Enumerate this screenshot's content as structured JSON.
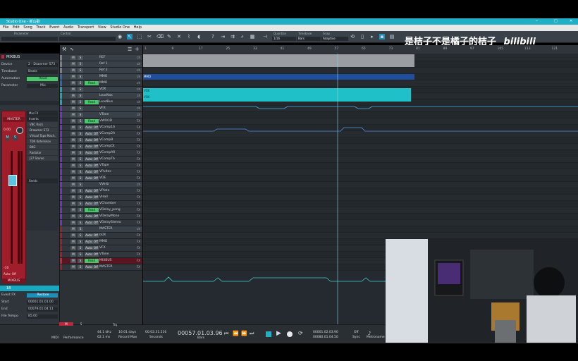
{
  "window": {
    "title": "Studio One - 新山歌",
    "controls": [
      "─",
      "□",
      "✕"
    ]
  },
  "menu": [
    "File",
    "Edit",
    "Song",
    "Track",
    "Event",
    "Audio",
    "Transport",
    "View",
    "Studio One",
    "Help"
  ],
  "toolbar": {
    "parameter_label": "Parameter",
    "control_label": "Control",
    "quantize_label": "Quantize",
    "quantize_value": "1/16",
    "timebase_label": "Timebase",
    "timebase_value": "Bars",
    "snap_label": "Snap",
    "snap_value": "Adaptive"
  },
  "watermark": {
    "text": "是桔子不是橘子的桔子",
    "logo": "bilibili"
  },
  "inspector": {
    "track_name": "MIXBUS",
    "rows": [
      {
        "label": "Device",
        "value": "2 - Drawmer S73"
      },
      {
        "label": "Timebase",
        "value": "Beats"
      },
      {
        "label": "Automation",
        "value": "Read"
      },
      {
        "label": "Parameter",
        "value": "Mix"
      }
    ],
    "channel_name": "MASTER",
    "channel_value": "0.00",
    "fx_title": "Mix FX",
    "inserts_label": "Inserts",
    "inserts": [
      "VBC Rack",
      "Drawmer S73",
      "Virtual Tape Mach.",
      "TDR Kotelnikov",
      "BKG",
      "Radiator",
      "J37 Stereo"
    ],
    "sends_label": "Sends",
    "fader_value": "-10",
    "auto_label": "Auto: Off",
    "strip_label": "MIXBUS",
    "event_track_no": "18",
    "event_fx_label": "Event FX",
    "event_fx_button": "Restore",
    "event_rows": [
      {
        "label": "Start",
        "value": "00001.01.01.00"
      },
      {
        "label": "End",
        "value": "00079.01.04.11"
      },
      {
        "label": "File Tempo",
        "value": "85.00"
      }
    ]
  },
  "tracks": [
    {
      "name": "REF",
      "color": "#7a7f85",
      "mode": "",
      "end": "ch"
    },
    {
      "name": "Ref 1",
      "color": "#7a7f85",
      "mode": "",
      "end": "ch"
    },
    {
      "name": "Ref 2",
      "color": "#7a7f85",
      "mode": "",
      "end": "ch"
    },
    {
      "name": "MMO",
      "color": "#2d6aa8",
      "mode": "",
      "end": "ch"
    },
    {
      "name": "MMO",
      "color": "#2d6aa8",
      "mode": "Read",
      "end": "ch"
    },
    {
      "name": "VOX",
      "color": "#1aa7a7",
      "mode": "",
      "end": "ch"
    },
    {
      "name": "LeadVox",
      "color": "#1aa7a7",
      "mode": "",
      "end": "ch"
    },
    {
      "name": "LeadBus",
      "color": "#1aa7a7",
      "mode": "Read",
      "end": "ch"
    },
    {
      "name": "VFX",
      "color": "#6a3bb0",
      "mode": "",
      "end": "ch"
    },
    {
      "name": "VTone",
      "color": "#6a3bb0",
      "mode": "",
      "end": "ch"
    },
    {
      "name": "VWOOD",
      "color": "#6a3bb0",
      "mode": "Read",
      "end": "FX"
    },
    {
      "name": "VComp1S",
      "color": "#6a3bb0",
      "mode": "Auto: Off",
      "end": "FX"
    },
    {
      "name": "VComp2A",
      "color": "#6a3bb0",
      "mode": "Auto: Off",
      "end": "FX"
    },
    {
      "name": "VCompB",
      "color": "#6a3bb0",
      "mode": "Auto: Off",
      "end": "FX"
    },
    {
      "name": "VCompOt",
      "color": "#6a3bb0",
      "mode": "Auto: Off",
      "end": "FX"
    },
    {
      "name": "VCompAR",
      "color": "#6a3bb0",
      "mode": "Auto: Off",
      "end": "FX"
    },
    {
      "name": "VCompTb",
      "color": "#6a3bb0",
      "mode": "Auto: Off",
      "end": "FX"
    },
    {
      "name": "VTape",
      "color": "#6a3bb0",
      "mode": "Auto: Off",
      "end": "FX"
    },
    {
      "name": "VPultec",
      "color": "#6a3bb0",
      "mode": "Auto: Off",
      "end": "FX"
    },
    {
      "name": "VDE",
      "color": "#6a3bb0",
      "mode": "Auto: Off",
      "end": "FX"
    },
    {
      "name": "VVerb",
      "color": "#6a3bb0",
      "mode": "",
      "end": "ch"
    },
    {
      "name": "VPlate",
      "color": "#6a3bb0",
      "mode": "Auto: Off",
      "end": "FX"
    },
    {
      "name": "VHall",
      "color": "#6a3bb0",
      "mode": "Auto: Off",
      "end": "FX"
    },
    {
      "name": "VChamber",
      "color": "#6a3bb0",
      "mode": "Auto: Off",
      "end": "FX"
    },
    {
      "name": "VDelay_pong",
      "color": "#6a3bb0",
      "mode": "Read",
      "end": "FX"
    },
    {
      "name": "VDelayMono",
      "color": "#6a3bb0",
      "mode": "Auto: Off",
      "end": "FX"
    },
    {
      "name": "VDelayStereo",
      "color": "#6a3bb0",
      "mode": "Auto: Off",
      "end": "FX"
    },
    {
      "name": "MASTER",
      "color": "#9b2030",
      "mode": "",
      "end": "ch"
    },
    {
      "name": "bOX",
      "color": "#9b2030",
      "mode": "Auto: Off",
      "end": "FX"
    },
    {
      "name": "MMO",
      "color": "#9b2030",
      "mode": "Auto: Off",
      "end": "FX"
    },
    {
      "name": "VFX",
      "color": "#9b2030",
      "mode": "Auto: Off",
      "end": "FX"
    },
    {
      "name": "VTone",
      "color": "#9b2030",
      "mode": "Auto: Off",
      "end": "FX"
    },
    {
      "name": "MIXBUS",
      "color": "#c0263a",
      "mode": "Read",
      "end": "FX"
    },
    {
      "name": "MASTER",
      "color": "#9b2030",
      "mode": "Auto: Off",
      "end": "FX"
    }
  ],
  "ruler_ticks": [
    "1",
    "9",
    "17",
    "25",
    "33",
    "41",
    "49",
    "57",
    "65",
    "73",
    "81",
    "89",
    "97",
    "105",
    "113",
    "121"
  ],
  "clips": {
    "mmo": "MMO",
    "vox1": "VOX",
    "vox2": "VOX"
  },
  "transport": {
    "midi_label": "MIDI",
    "performance_label": "Performance",
    "sample_rate": "44.1 kHz",
    "latency": "62.1 ms",
    "record_time": "16:01 days",
    "record_label": "Record Max",
    "seconds_value": "00:02:31.516",
    "seconds_label": "Seconds",
    "position": "00057.01.03.96",
    "position_label": "Bars",
    "loop_start": "00001.02.03.90",
    "loop_end": "00080.01.04.50",
    "sync_value": "Off",
    "sync_label": "Sync",
    "metro_label": "Metronome",
    "track_list_label": "Trq"
  }
}
